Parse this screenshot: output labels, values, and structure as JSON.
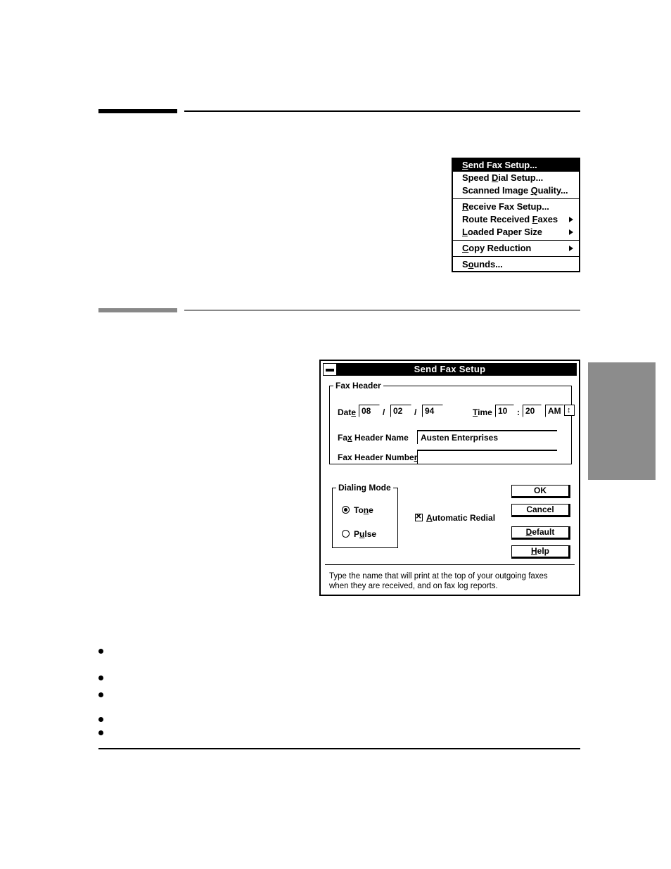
{
  "page": {
    "rules": {
      "top_accent_color": "#000000",
      "mid_accent_color": "#888888",
      "side_tab_color": "#8c8c8c"
    },
    "bullets": [
      "",
      "",
      "",
      "",
      ""
    ]
  },
  "menu": {
    "name": "fax-settings-menu",
    "items": [
      {
        "label": "Send Fax Setup...",
        "accel": "S",
        "highlighted": true,
        "submenu": false,
        "separator_after": false
      },
      {
        "label": "Speed Dial Setup...",
        "accel": "D",
        "highlighted": false,
        "submenu": false,
        "separator_after": false
      },
      {
        "label": "Scanned Image Quality...",
        "accel": "Q",
        "highlighted": false,
        "submenu": false,
        "separator_after": true
      },
      {
        "label": "Receive Fax Setup...",
        "accel": "R",
        "highlighted": false,
        "submenu": false,
        "separator_after": false
      },
      {
        "label": "Route Received Faxes",
        "accel": "F",
        "highlighted": false,
        "submenu": true,
        "separator_after": false
      },
      {
        "label": "Loaded Paper Size",
        "accel": "L",
        "highlighted": false,
        "submenu": true,
        "separator_after": true
      },
      {
        "label": "Copy Reduction",
        "accel": "C",
        "highlighted": false,
        "submenu": true,
        "separator_after": true
      },
      {
        "label": "Sounds...",
        "accel": "o",
        "highlighted": false,
        "submenu": false,
        "separator_after": false
      }
    ]
  },
  "dialog": {
    "title": "Send Fax Setup",
    "fax_header": {
      "legend": "Fax Header",
      "date_label": "Date",
      "date_month": "08",
      "date_day": "02",
      "date_year": "94",
      "date_sep": "/",
      "time_label": "Time",
      "time_hour": "10",
      "time_minute": "20",
      "time_sep": ":",
      "ampm_value": "AM",
      "name_label": "Fax Header Name",
      "name_value": "Austen Enterprises",
      "number_label": "Fax Header Number",
      "number_value": ""
    },
    "dialing_mode": {
      "legend": "Dialing Mode",
      "options": [
        {
          "label": "Tone",
          "selected": true
        },
        {
          "label": "Pulse",
          "selected": false
        }
      ]
    },
    "automatic_redial": {
      "label": "Automatic Redial",
      "checked": true
    },
    "buttons": [
      {
        "label": "OK"
      },
      {
        "label": "Cancel"
      },
      {
        "label": "Default"
      },
      {
        "label": "Help"
      }
    ],
    "help_text": "Type the name that will print at the top of your outgoing faxes when they are received, and on fax log reports."
  }
}
